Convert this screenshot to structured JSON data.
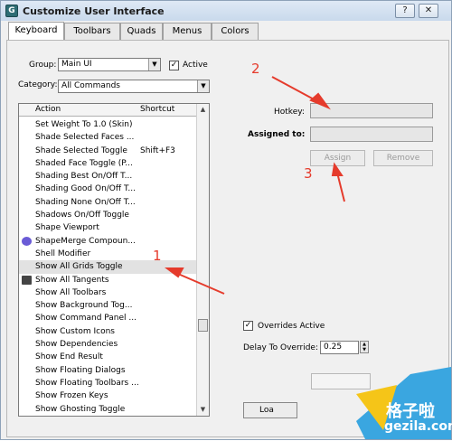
{
  "window": {
    "title": "Customize User Interface",
    "icon_letter": "G",
    "help_label": "?",
    "close_label": "✕"
  },
  "tabs": [
    {
      "label": "Keyboard"
    },
    {
      "label": "Toolbars"
    },
    {
      "label": "Quads"
    },
    {
      "label": "Menus"
    },
    {
      "label": "Colors"
    }
  ],
  "group": {
    "label": "Group:",
    "value": "Main UI",
    "active_label": "Active",
    "active_checked": "✓"
  },
  "category": {
    "label": "Category:",
    "value": "All Commands"
  },
  "list": {
    "col_action": "Action",
    "col_shortcut": "Shortcut",
    "rows": [
      {
        "action": "Set Weight To 1.0 (Skin)",
        "shortcut": ""
      },
      {
        "action": "Shade Selected Faces ...",
        "shortcut": ""
      },
      {
        "action": "Shade Selected Toggle",
        "shortcut": "Shift+F3"
      },
      {
        "action": "Shaded Face Toggle (P...",
        "shortcut": ""
      },
      {
        "action": "Shading Best On/Off T...",
        "shortcut": ""
      },
      {
        "action": "Shading Good On/Off T...",
        "shortcut": ""
      },
      {
        "action": "Shading None On/Off T...",
        "shortcut": ""
      },
      {
        "action": "Shadows On/Off Toggle",
        "shortcut": ""
      },
      {
        "action": "Shape Viewport",
        "shortcut": ""
      },
      {
        "action": "ShapeMerge Compoun...",
        "shortcut": ""
      },
      {
        "action": "Shell Modifier",
        "shortcut": ""
      },
      {
        "action": "Show All Grids Toggle",
        "shortcut": ""
      },
      {
        "action": "Show All Tangents",
        "shortcut": ""
      },
      {
        "action": "Show All Toolbars",
        "shortcut": ""
      },
      {
        "action": "Show Background Tog...",
        "shortcut": ""
      },
      {
        "action": "Show Command Panel ...",
        "shortcut": ""
      },
      {
        "action": "Show Custom Icons",
        "shortcut": ""
      },
      {
        "action": "Show Dependencies",
        "shortcut": ""
      },
      {
        "action": "Show End Result",
        "shortcut": ""
      },
      {
        "action": "Show Floating Dialogs",
        "shortcut": ""
      },
      {
        "action": "Show Floating Toolbars ...",
        "shortcut": ""
      },
      {
        "action": "Show Frozen Keys",
        "shortcut": ""
      },
      {
        "action": "Show Ghosting Toggle",
        "shortcut": ""
      }
    ]
  },
  "hotkey": {
    "label": "Hotkey:",
    "value": ""
  },
  "assigned": {
    "label": "Assigned to:",
    "value": ""
  },
  "buttons": {
    "assign": "Assign",
    "remove": "Remove",
    "load": "Loa"
  },
  "overrides": {
    "label": "Overrides Active",
    "checked": "✓"
  },
  "delay": {
    "label": "Delay To Override:",
    "value": "0.25"
  },
  "annotations": {
    "n1": "1",
    "n2": "2",
    "n3": "3"
  },
  "watermark": {
    "line1": "格子啦",
    "line2": "gezila.com"
  },
  "colors": {
    "accent_red": "#e53b2c"
  }
}
